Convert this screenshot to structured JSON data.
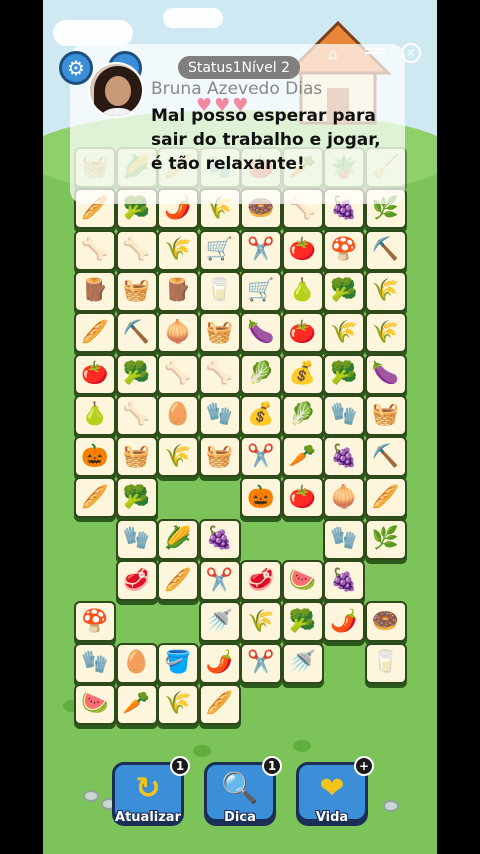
{
  "banner": {
    "status_label": "Status1",
    "level_label": "Nível 2",
    "sender": "Bruna Azevedo Dias",
    "message": "Mal posso esperar para sair do trabalho e jogar, é tão relaxante!"
  },
  "top_icons": {
    "settings": "gear-icon",
    "search": "search-icon",
    "home": "home-icon",
    "close": "close-icon",
    "hearts": "♥♥♥"
  },
  "buttons": [
    {
      "label": "Atualizar",
      "badge": "1",
      "icon": "↻",
      "icon_name": "refresh-icon",
      "color": "#f3c21d"
    },
    {
      "label": "Dica",
      "badge": "1",
      "icon": "🔍",
      "icon_name": "magnifier-icon",
      "color": "#f3c21d"
    },
    {
      "label": "Vida",
      "badge": "+",
      "icon": "❤",
      "icon_name": "heart-plus-icon",
      "color": "#f3c21d"
    }
  ],
  "tiles": [
    {
      "r": 0,
      "c": 0,
      "g": "🧺",
      "top": true
    },
    {
      "r": 0,
      "c": 1,
      "g": "🌽",
      "top": true
    },
    {
      "r": 0,
      "c": 2,
      "g": "🥖",
      "top": true
    },
    {
      "r": 0,
      "c": 3,
      "g": "🧤",
      "top": true
    },
    {
      "r": 0,
      "c": 4,
      "g": "🍅",
      "top": true
    },
    {
      "r": 0,
      "c": 5,
      "g": "🥕",
      "top": true
    },
    {
      "r": 0,
      "c": 6,
      "g": "🪴",
      "top": true
    },
    {
      "r": 0,
      "c": 7,
      "g": "🧹",
      "top": true
    },
    {
      "r": 1,
      "c": 0,
      "g": "🥖"
    },
    {
      "r": 1,
      "c": 1,
      "g": "🥦"
    },
    {
      "r": 1,
      "c": 2,
      "g": "🌶️"
    },
    {
      "r": 1,
      "c": 3,
      "g": "🌾"
    },
    {
      "r": 1,
      "c": 4,
      "g": "🍩"
    },
    {
      "r": 1,
      "c": 5,
      "g": "🦴"
    },
    {
      "r": 1,
      "c": 6,
      "g": "🍇"
    },
    {
      "r": 1,
      "c": 7,
      "g": "🌿"
    },
    {
      "r": 2,
      "c": 0,
      "g": "🦴"
    },
    {
      "r": 2,
      "c": 1,
      "g": "🦴"
    },
    {
      "r": 2,
      "c": 2,
      "g": "🌾"
    },
    {
      "r": 2,
      "c": 3,
      "g": "🛒"
    },
    {
      "r": 2,
      "c": 4,
      "g": "✂️"
    },
    {
      "r": 2,
      "c": 5,
      "g": "🍅"
    },
    {
      "r": 2,
      "c": 6,
      "g": "🍄"
    },
    {
      "r": 2,
      "c": 7,
      "g": "⛏️"
    },
    {
      "r": 3,
      "c": 0,
      "g": "🪵"
    },
    {
      "r": 3,
      "c": 1,
      "g": "🧺"
    },
    {
      "r": 3,
      "c": 2,
      "g": "🪵"
    },
    {
      "r": 3,
      "c": 3,
      "g": "🥛"
    },
    {
      "r": 3,
      "c": 4,
      "g": "🛒"
    },
    {
      "r": 3,
      "c": 5,
      "g": "🍐"
    },
    {
      "r": 3,
      "c": 6,
      "g": "🥦"
    },
    {
      "r": 3,
      "c": 7,
      "g": "🌾"
    },
    {
      "r": 4,
      "c": 0,
      "g": "🥖"
    },
    {
      "r": 4,
      "c": 1,
      "g": "⛏️"
    },
    {
      "r": 4,
      "c": 2,
      "g": "🧅"
    },
    {
      "r": 4,
      "c": 3,
      "g": "🧺"
    },
    {
      "r": 4,
      "c": 4,
      "g": "🍆"
    },
    {
      "r": 4,
      "c": 5,
      "g": "🍅"
    },
    {
      "r": 4,
      "c": 6,
      "g": "🌾"
    },
    {
      "r": 4,
      "c": 7,
      "g": "🌾"
    },
    {
      "r": 5,
      "c": 0,
      "g": "🍅"
    },
    {
      "r": 5,
      "c": 1,
      "g": "🥦"
    },
    {
      "r": 5,
      "c": 2,
      "g": "🦴"
    },
    {
      "r": 5,
      "c": 3,
      "g": "🦴"
    },
    {
      "r": 5,
      "c": 4,
      "g": "🥬"
    },
    {
      "r": 5,
      "c": 5,
      "g": "💰"
    },
    {
      "r": 5,
      "c": 6,
      "g": "🥦"
    },
    {
      "r": 5,
      "c": 7,
      "g": "🍆"
    },
    {
      "r": 6,
      "c": 0,
      "g": "🍐"
    },
    {
      "r": 6,
      "c": 1,
      "g": "🦴"
    },
    {
      "r": 6,
      "c": 2,
      "g": "🥚"
    },
    {
      "r": 6,
      "c": 3,
      "g": "🧤"
    },
    {
      "r": 6,
      "c": 4,
      "g": "💰"
    },
    {
      "r": 6,
      "c": 5,
      "g": "🥬"
    },
    {
      "r": 6,
      "c": 6,
      "g": "🧤"
    },
    {
      "r": 6,
      "c": 7,
      "g": "🧺"
    },
    {
      "r": 7,
      "c": 0,
      "g": "🎃"
    },
    {
      "r": 7,
      "c": 1,
      "g": "🧺"
    },
    {
      "r": 7,
      "c": 2,
      "g": "🌾"
    },
    {
      "r": 7,
      "c": 3,
      "g": "🧺"
    },
    {
      "r": 7,
      "c": 4,
      "g": "✂️"
    },
    {
      "r": 7,
      "c": 5,
      "g": "🥕"
    },
    {
      "r": 7,
      "c": 6,
      "g": "🍇"
    },
    {
      "r": 7,
      "c": 7,
      "g": "⛏️"
    },
    {
      "r": 8,
      "c": 0,
      "g": "🥖"
    },
    {
      "r": 8,
      "c": 1,
      "g": "🥦"
    },
    {
      "r": 8,
      "c": 4,
      "g": "🎃"
    },
    {
      "r": 8,
      "c": 5,
      "g": "🍅"
    },
    {
      "r": 8,
      "c": 6,
      "g": "🧅"
    },
    {
      "r": 8,
      "c": 7,
      "g": "🥖"
    },
    {
      "r": 9,
      "c": 1,
      "g": "🧤"
    },
    {
      "r": 9,
      "c": 2,
      "g": "🌽"
    },
    {
      "r": 9,
      "c": 3,
      "g": "🍇"
    },
    {
      "r": 9,
      "c": 6,
      "g": "🧤"
    },
    {
      "r": 9,
      "c": 7,
      "g": "🌿"
    },
    {
      "r": 10,
      "c": 1,
      "g": "🥩"
    },
    {
      "r": 10,
      "c": 2,
      "g": "🥖"
    },
    {
      "r": 10,
      "c": 3,
      "g": "✂️"
    },
    {
      "r": 10,
      "c": 4,
      "g": "🥩"
    },
    {
      "r": 10,
      "c": 5,
      "g": "🍉"
    },
    {
      "r": 10,
      "c": 6,
      "g": "🍇"
    },
    {
      "r": 11,
      "c": 0,
      "g": "🍄"
    },
    {
      "r": 11,
      "c": 3,
      "g": "🚿"
    },
    {
      "r": 11,
      "c": 4,
      "g": "🌾"
    },
    {
      "r": 11,
      "c": 5,
      "g": "🥦"
    },
    {
      "r": 11,
      "c": 6,
      "g": "🌶️"
    },
    {
      "r": 11,
      "c": 7,
      "g": "🍩"
    },
    {
      "r": 12,
      "c": 0,
      "g": "🧤"
    },
    {
      "r": 12,
      "c": 1,
      "g": "🥚"
    },
    {
      "r": 12,
      "c": 2,
      "g": "🪣"
    },
    {
      "r": 12,
      "c": 3,
      "g": "🌶️"
    },
    {
      "r": 12,
      "c": 4,
      "g": "✂️"
    },
    {
      "r": 12,
      "c": 5,
      "g": "🚿"
    },
    {
      "r": 12,
      "c": 7,
      "g": "🥛"
    },
    {
      "r": 13,
      "c": 0,
      "g": "🍉"
    },
    {
      "r": 13,
      "c": 1,
      "g": "🥕"
    },
    {
      "r": 13,
      "c": 2,
      "g": "🌾"
    },
    {
      "r": 13,
      "c": 3,
      "g": "🥖"
    }
  ]
}
